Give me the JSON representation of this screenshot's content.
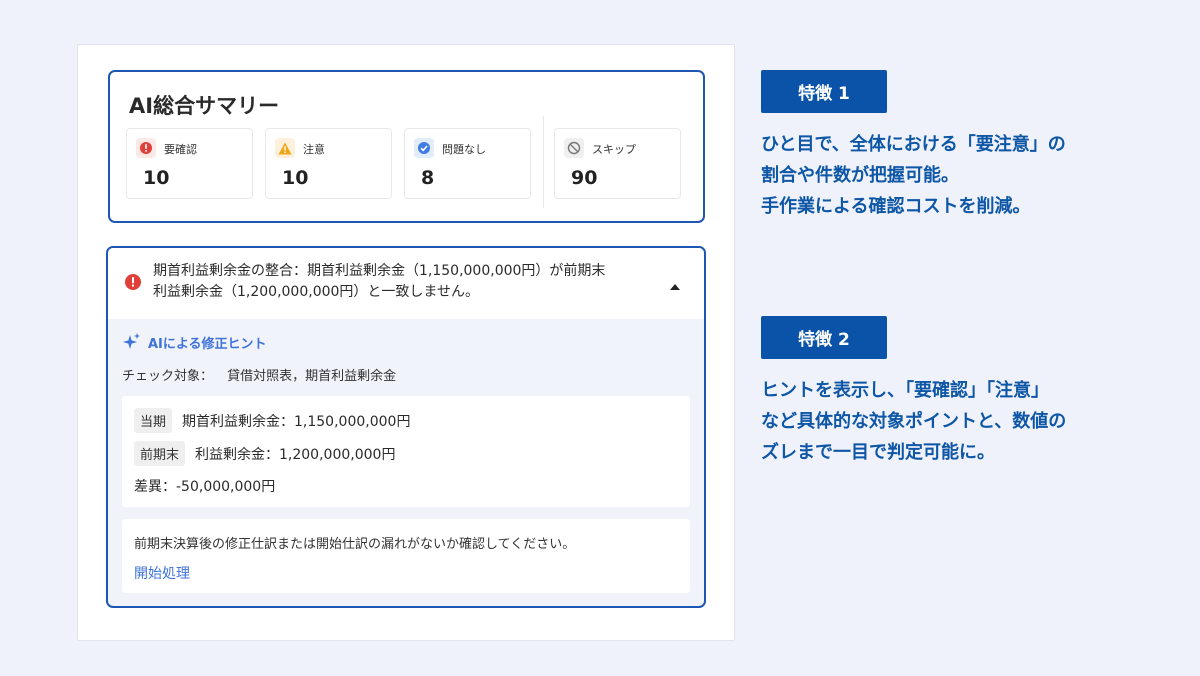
{
  "summary": {
    "title": "AI総合サマリー",
    "stats": [
      {
        "label": "要確認",
        "value": "10",
        "icon": "error-icon",
        "color": "#e0403a",
        "bg": "#fde8e8"
      },
      {
        "label": "注意",
        "value": "10",
        "icon": "warning-icon",
        "color": "#f2a516",
        "bg": "#fdf1dc"
      },
      {
        "label": "問題なし",
        "value": "8",
        "icon": "check-icon",
        "color": "#3f7be0",
        "bg": "#e3ecfb"
      },
      {
        "label": "スキップ",
        "value": "90",
        "icon": "skip-icon",
        "color": "#888888",
        "bg": "#efefef"
      }
    ]
  },
  "issue": {
    "message_line1": "期首利益剰余金の整合：期首利益剰余金（1,150,000,000円）が前期末",
    "message_line2": "利益剰余金（1,200,000,000円）と一致しません。",
    "hint_title": "AIによる修正ヒント",
    "check_target_label": "チェック対象：",
    "check_target_value": "貸借対照表，期首利益剰余金",
    "current_chip": "当期",
    "current_text": "期首利益剰余金：1,150,000,000円",
    "prior_chip": "前期末",
    "prior_text": "利益剰余金：1,200,000,000円",
    "diff_text": "差異：-50,000,000円",
    "note": "前期末決算後の修正仕訳または開始仕訳の漏れがないか確認してください。",
    "link": "開始処理"
  },
  "features": [
    {
      "badge": "特徴 1",
      "lines": [
        "ひと目で、全体における「要注意」の",
        "割合や件数が把握可能。",
        "手作業による確認コストを削減。"
      ]
    },
    {
      "badge": "特徴 2",
      "lines": [
        "ヒントを表示し、「要確認」「注意」",
        "など具体的な対象ポイントと、数値の",
        "ズレまで一目で判定可能に。"
      ]
    }
  ],
  "colors": {
    "accent": "#1d56b3",
    "badge": "#0a53a8",
    "feature_text": "#0e56a6",
    "link": "#3f73d8"
  }
}
